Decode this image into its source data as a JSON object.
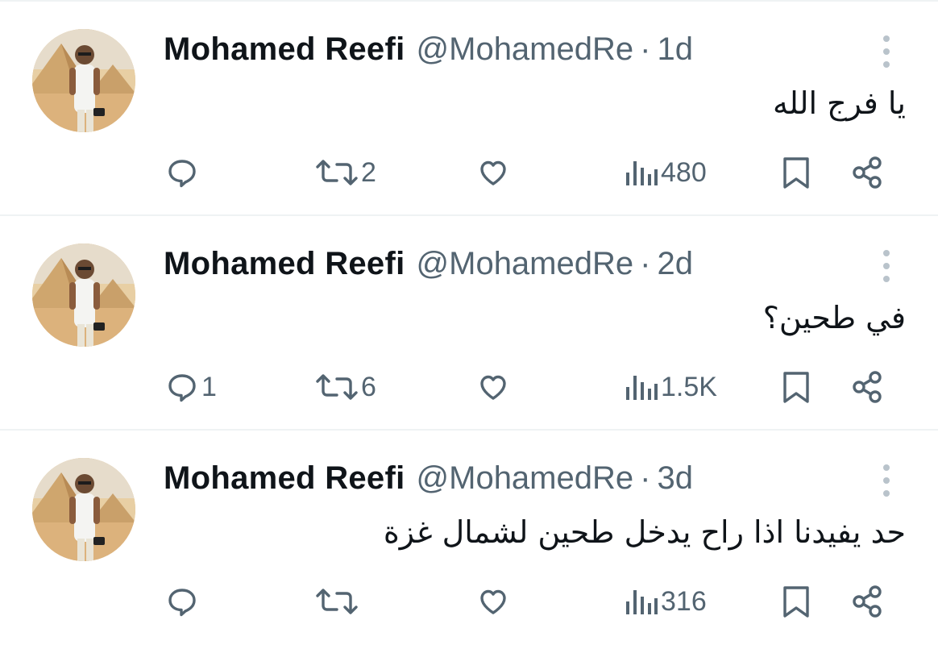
{
  "tweets": [
    {
      "name": "Mohamed Reefi",
      "handle": "@MohamedRe",
      "separator": "·",
      "time": "1d",
      "text": "يا فرج الله",
      "replies": "",
      "retweets": "2",
      "likes": "",
      "views": "480"
    },
    {
      "name": "Mohamed Reefi",
      "handle": "@MohamedRe",
      "separator": "·",
      "time": "2d",
      "text": "في طحين؟",
      "replies": "1",
      "retweets": "6",
      "likes": "",
      "views": "1.5K"
    },
    {
      "name": "Mohamed Reefi",
      "handle": "@MohamedRe",
      "separator": "·",
      "time": "3d",
      "text": "حد يفيدنا اذا راح يدخل طحين لشمال غزة",
      "replies": "",
      "retweets": "",
      "likes": "",
      "views": "316"
    }
  ],
  "icons": {
    "reply": "reply-icon",
    "retweet": "retweet-icon",
    "like": "heart-icon",
    "views": "views-icon",
    "bookmark": "bookmark-icon",
    "share": "share-icon",
    "more": "more-options-icon"
  },
  "colors": {
    "text_primary": "#0f1419",
    "text_secondary": "#536471",
    "divider": "#eff3f4",
    "more_dots": "#b9c3cb"
  }
}
